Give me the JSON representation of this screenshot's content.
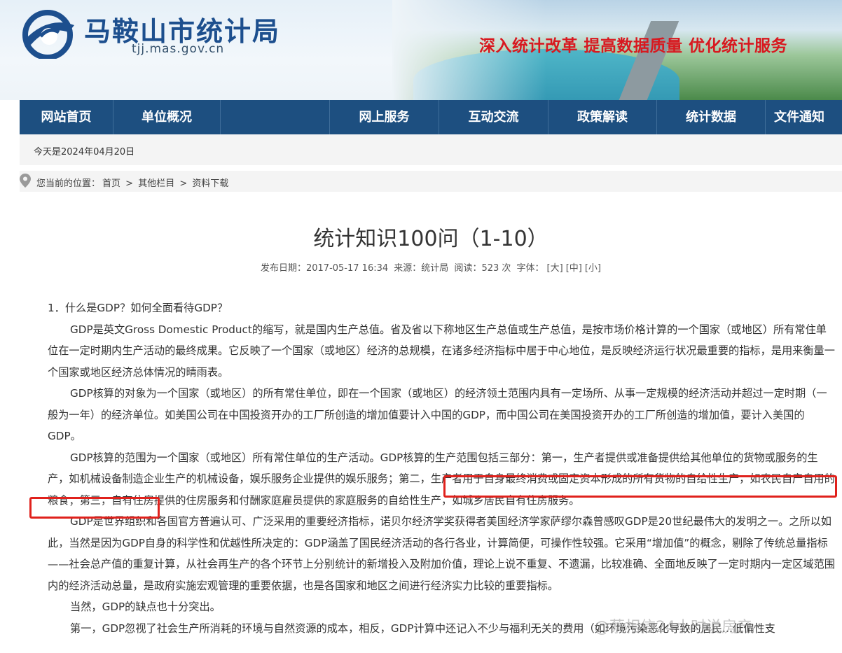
{
  "header": {
    "site_title": "马鞍山市统计局",
    "site_domain": "tjj.mas.gov.cn",
    "slogan": "深入统计改革  提高数据质量  优化统计服务"
  },
  "nav": {
    "items": [
      {
        "label": "网站首页"
      },
      {
        "label": "单位概况"
      },
      {
        "label": "",
        "blurred": true
      },
      {
        "label": "网上服务"
      },
      {
        "label": "互动交流"
      },
      {
        "label": "政策解读"
      },
      {
        "label": "统计数据"
      },
      {
        "label": "文件通知"
      }
    ]
  },
  "date_bar": {
    "text": "今天是2024年04月20日"
  },
  "breadcrumb": {
    "prefix": "您当前的位置：",
    "items": [
      "首页",
      ">",
      "其他栏目",
      ">",
      "资料下载"
    ]
  },
  "article": {
    "title": "统计知识100问（1-10）",
    "meta": {
      "publish": "发布日期：2017-05-17 16:34",
      "source": "来源：统计局",
      "reads": "阅读：523 次",
      "font_label": "字体：",
      "size_large": "[大]",
      "size_medium": "[中]",
      "size_small": "[小]"
    },
    "paragraphs": [
      {
        "type": "q",
        "text": "1．什么是GDP？如何全面看待GDP？"
      },
      {
        "type": "p",
        "text": "GDP是英文Gross Domestic Product的缩写，就是国内生产总值。省及省以下称地区生产总值或生产总值，是按市场价格计算的一个国家（或地区）所有常住单位在一定时期内生产活动的最终成果。它反映了一个国家（或地区）经济的总规模，在诸多经济指标中居于中心地位，是反映经济运行状况最重要的指标，是用来衡量一个国家或地区经济总体情况的晴雨表。"
      },
      {
        "type": "p",
        "text": "GDP核算的对象为一个国家（或地区）的所有常住单位，即在一个国家（或地区）的经济领土范围内具有一定场所、从事一定规模的经济活动并超过一定时期（一般为一年）的经济单位。如美国公司在中国投资开办的工厂所创造的增加值要计入中国的GDP，而中国公司在美国投资开办的工厂所创造的增加值，要计入美国的GDP。"
      },
      {
        "type": "p",
        "text": "GDP核算的范围为一个国家（或地区）所有常住单位的生产活动。GDP核算的生产范围包括三部分：第一，生产者提供或准备提供给其他单位的货物或服务的生产，如机械设备制造企业生产的机械设备，娱乐服务企业提供的娱乐服务；第二，生产者用于自身最终消费或固定资本形成的所有货物的自给性生产，如农民自产自用的粮食；第三，自有住房提供的住房服务和付酬家庭雇员提供的家庭服务的自给性生产，如城乡居民自有住房服务。"
      },
      {
        "type": "p",
        "text": "GDP是世界组织和各国官方普遍认可、广泛采用的重要经济指标，诺贝尔经济学奖获得者美国经济学家萨缪尔森曾感叹GDP是20世纪最伟大的发明之一。之所以如此，当然是因为GDP自身的科学性和优越性所决定的：GDP涵盖了国民经济活动的各行各业，计算简便，可操作性较强。它采用“增加值”的概念，剔除了传统总量指标——社会总产值的重复计算，从社会再生产的各个环节上分别统计的新增投入及附加价值，理论上说不重复、不遗漏，比较准确、全面地反映了一定时期内一定区域范围内的经济活动总量，是政府实施宏观管理的重要依据，也是各国家和地区之间进行经济实力比较的重要指标。"
      },
      {
        "type": "p",
        "text": "当然，GDP的缺点也十分突出。"
      },
      {
        "type": "p",
        "text": "第一，GDP忽视了社会生产所消耗的环境与自然资源的成本，相反，GDP计算中还记入不少与福利无关的费用（如环境污染恶化导致的居民…低偏性支"
      }
    ]
  },
  "watermark": "@蔡相信24小时说房产"
}
